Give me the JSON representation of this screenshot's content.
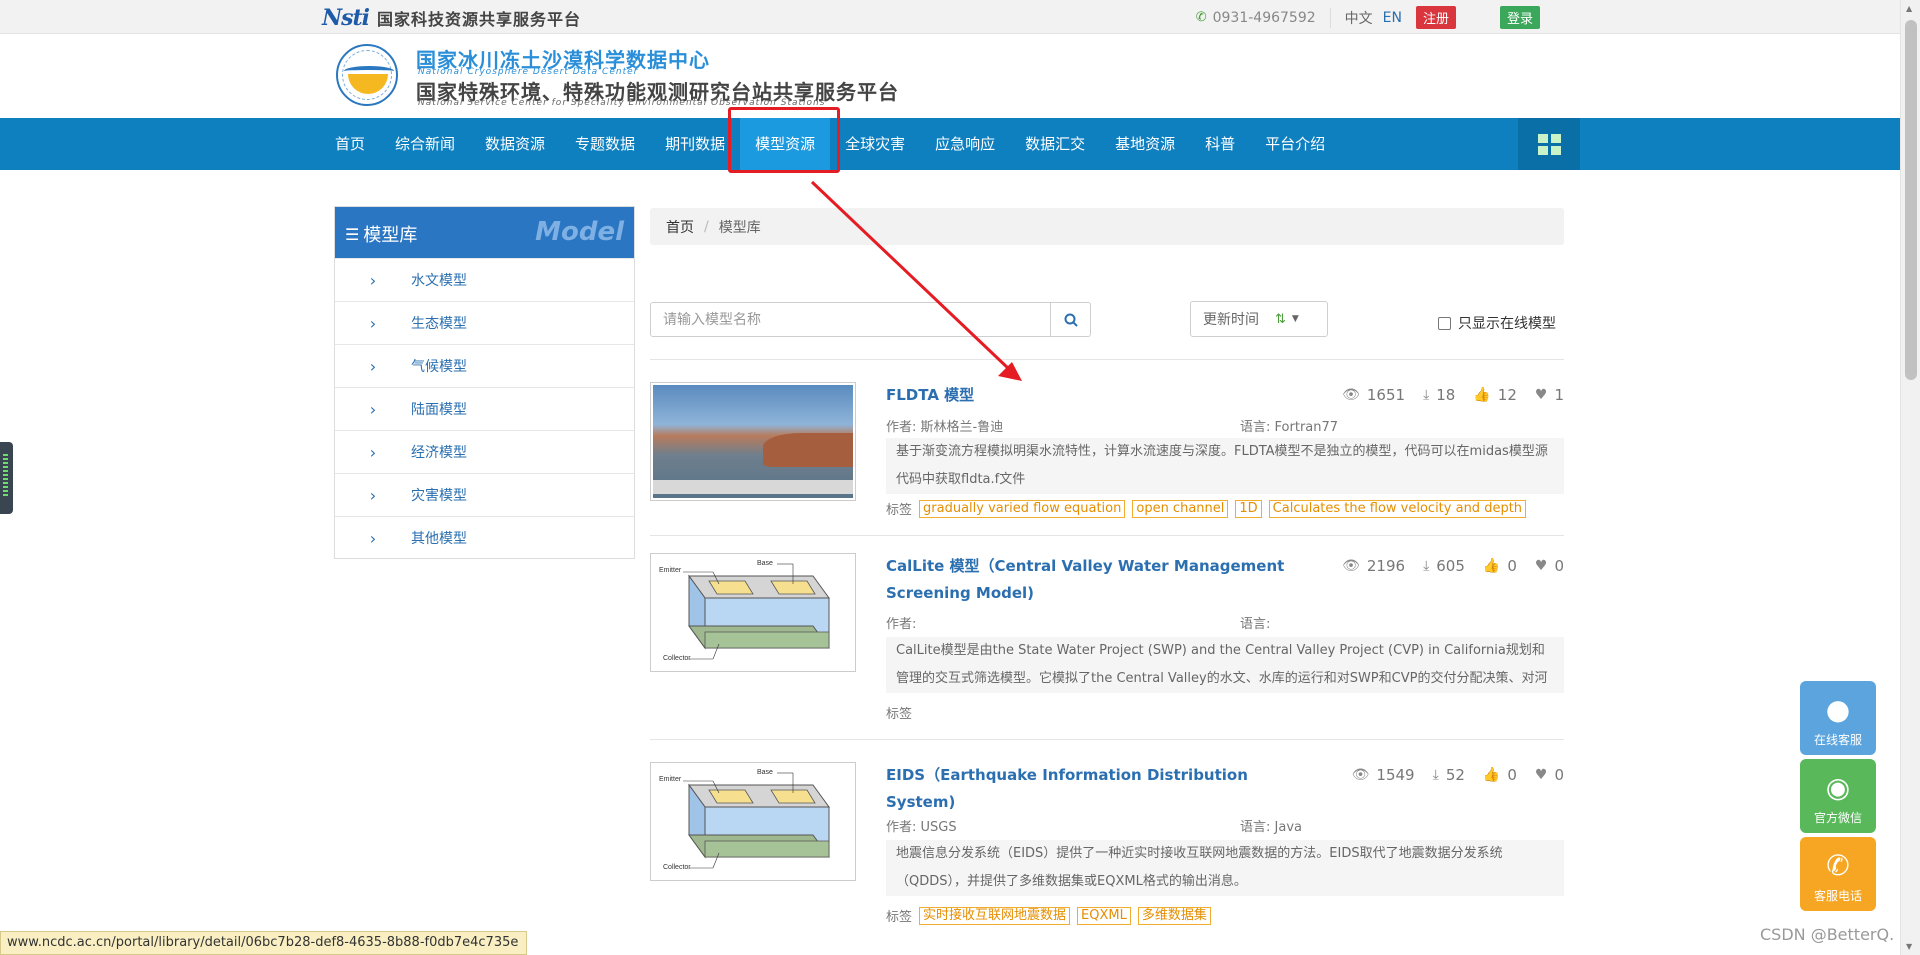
{
  "topbar": {
    "logo_text": "Nsti",
    "platform_name": "国家科技资源共享服务平台",
    "phone": "0931-4967592",
    "lang_cn": "中文",
    "lang_en": "EN",
    "register_label": "注册",
    "login_label": "登录"
  },
  "header": {
    "title_cn_1": "国家冰川冻土沙漠科学数据中心",
    "title_en_1": "National Cryosphere Desert Data Center",
    "title_cn_2": "国家特殊环境、特殊功能观测研究台站共享服务平台",
    "title_en_2": "National Service Center for Speciality Environmental Observation Stations"
  },
  "nav": {
    "items": [
      {
        "label": "首页"
      },
      {
        "label": "综合新闻"
      },
      {
        "label": "数据资源"
      },
      {
        "label": "专题数据"
      },
      {
        "label": "期刊数据"
      },
      {
        "label": "模型资源"
      },
      {
        "label": "全球灾害"
      },
      {
        "label": "应急响应"
      },
      {
        "label": "数据汇交"
      },
      {
        "label": "基地资源"
      },
      {
        "label": "科普"
      },
      {
        "label": "平台介绍"
      }
    ],
    "active": "模型资源"
  },
  "sidebar": {
    "title": "模型库",
    "watermark": "Model",
    "items": [
      {
        "label": "水文模型"
      },
      {
        "label": "生态模型"
      },
      {
        "label": "气候模型"
      },
      {
        "label": "陆面模型"
      },
      {
        "label": "经济模型"
      },
      {
        "label": "灾害模型"
      },
      {
        "label": "其他模型"
      }
    ]
  },
  "breadcrumb": {
    "home": "首页",
    "separator": "/",
    "current": "模型库"
  },
  "search": {
    "placeholder": "请输入模型名称",
    "sort_label": "更新时间",
    "online_only_label": "只显示在线模型"
  },
  "models": [
    {
      "title": "FLDTA 模型",
      "views": "1651",
      "downloads": "18",
      "likes": "12",
      "favorites": "1",
      "author_label": "作者:",
      "author": "斯林格兰-鲁迪",
      "language_label": "语言:",
      "language": "Fortran77",
      "description": "基于渐变流方程模拟明渠水流特性，计算水流速度与深度。FLDTA模型不是独立的模型，代码可以在midas模型源代码中获取fldta.f文件",
      "tags_label": "标签",
      "tags": [
        "gradually varied flow equation",
        "open channel",
        "1D",
        "Calculates the flow velocity and depth"
      ]
    },
    {
      "title": "CalLite 模型（Central Valley Water Management Screening Model)",
      "views": "2196",
      "downloads": "605",
      "likes": "0",
      "favorites": "0",
      "author_label": "作者:",
      "author": "",
      "language_label": "语言:",
      "language": "",
      "description": "CalLite模型是由the State Water Project (SWP) and the Central Valley Project (CVP) in California规划和管理的交互式筛选模型。它模拟了the Central Valley的水文、水库的运行和对SWP和CVP的交付分配决策、对河流流量和出口变",
      "tags_label": "标签",
      "tags": []
    },
    {
      "title": "EIDS（Earthquake Information Distribution System)",
      "views": "1549",
      "downloads": "52",
      "likes": "0",
      "favorites": "0",
      "author_label": "作者:",
      "author": "USGS",
      "language_label": "语言:",
      "language": "Java",
      "description": "地震信息分发系统（EIDS）提供了一种近实时接收互联网地震数据的方法。EIDS取代了地震数据分发系统（QDDS），并提供了多维数据集或EQXML格式的输出消息。",
      "tags_label": "标签",
      "tags": [
        "实时接收互联网地震数据",
        "EQXML",
        "多维数据集"
      ]
    }
  ],
  "diagram_labels": {
    "emitter": "Emitter",
    "base": "Base",
    "collector": "Collector"
  },
  "float_buttons": {
    "qq": "在线客服",
    "wechat": "官方微信",
    "phone": "客服电话"
  },
  "status_url": "www.ncdc.ac.cn/portal/library/detail/06bc7b28-def8-4635-8b88-f0db7e4c735e",
  "watermark": "CSDN @BetterQ.",
  "colors": {
    "nav_bg": "#0e7fbf",
    "nav_active": "#1b9ae0",
    "link": "#2b6fb0",
    "tag": "#e58e00",
    "annotation_red": "#e51c23"
  }
}
